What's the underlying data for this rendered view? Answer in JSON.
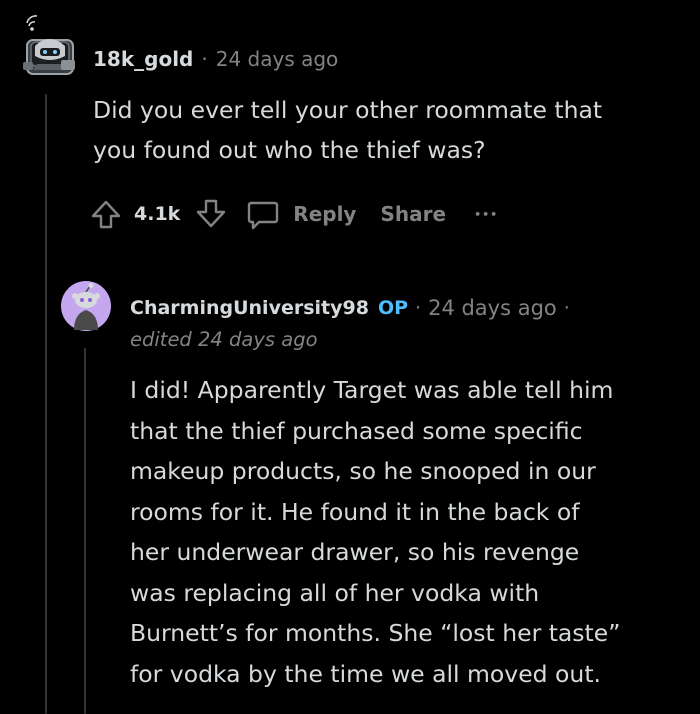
{
  "comment1": {
    "username": "18k_gold",
    "separator": "·",
    "time": "24 days ago",
    "body": "Did you ever tell your other roommate that\nyou found out who the thief was?",
    "votes": "4.1k",
    "actions": {
      "reply": "Reply",
      "share": "Share",
      "more": "•••"
    },
    "icons": {
      "avatar": "snoo-avatar-icon",
      "upvote": "upvote-arrow-icon",
      "downvote": "downvote-arrow-icon",
      "reply": "speech-bubble-icon",
      "more": "more-options-icon"
    }
  },
  "comment2": {
    "username": "CharmingUniversity98",
    "op_badge": "OP",
    "separator": "·",
    "time": "24 days ago",
    "trailing_separator": "·",
    "edited": "edited 24 days ago",
    "body": "I did! Apparently Target was able tell him\nthat the thief purchased some specific\nmakeup products, so he snooped in our\nrooms for it. He found it in the back of\nher underwear drawer, so his revenge\nwas replacing all of her vodka with\nBurnett’s for months. She “lost her taste”\nfor vodka by the time we all moved out.",
    "icons": {
      "avatar": "default-snoo-avatar-icon"
    }
  },
  "colors": {
    "background": "#000000",
    "text": "#d7dadc",
    "meta": "#818384",
    "op": "#4fbcff",
    "thread_line": "#343536",
    "avatar2_bg": "#c5a7f0"
  }
}
